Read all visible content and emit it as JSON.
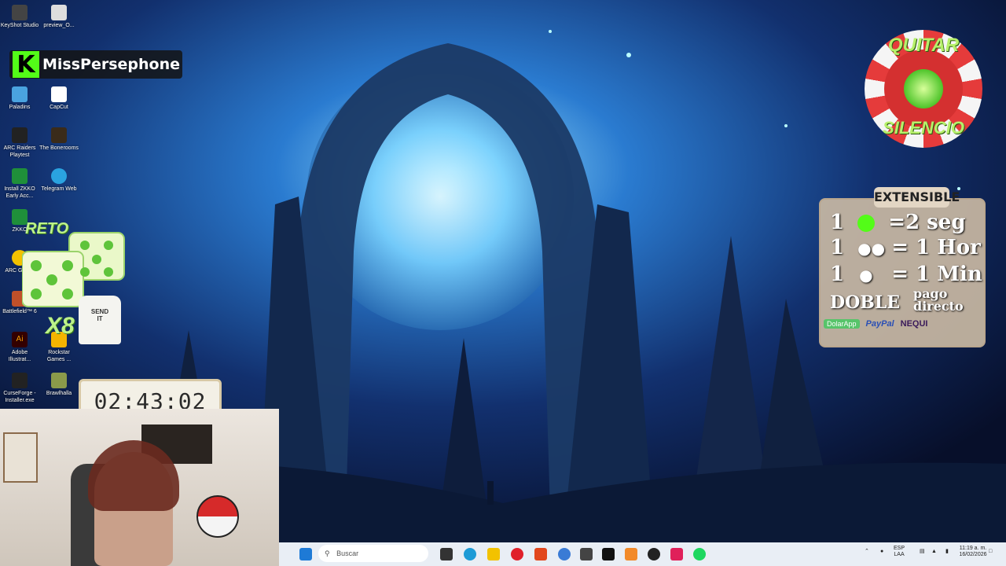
{
  "desktop_icons": [
    {
      "label": "KeyShot Studio",
      "color": "#444444"
    },
    {
      "label": "preview_O...",
      "color": "#dddddd"
    },
    {
      "label": "Paladins",
      "color": "#4aa3df"
    },
    {
      "label": "CapCut",
      "color": "#ffffff"
    },
    {
      "label": "ARC Raiders Playtest",
      "color": "#222222"
    },
    {
      "label": "The Bonerooms",
      "color": "#3a2b1a"
    },
    {
      "label": "Install ZKKO Early Acc...",
      "color": "#1f8f3a"
    },
    {
      "label": "Telegram Web",
      "color": "#2aa3e0"
    },
    {
      "label": "ZKKO",
      "color": "#1f8f3a"
    },
    {
      "label": "ARC GAME",
      "color": "#f2c200"
    },
    {
      "label": "Battlefield™ 6",
      "color": "#c0502a"
    },
    {
      "label": "Adobe Illustrat...",
      "color": "#ff9a00"
    },
    {
      "label": "Rockstar Games ...",
      "color": "#f4b400"
    },
    {
      "label": "CurseForge - Installer.exe",
      "color": "#222222"
    },
    {
      "label": "Brawlhalla",
      "color": "#8a9a4a"
    }
  ],
  "overlay": {
    "kick_letter": "K",
    "streamer_name": "MissPersephone",
    "quit_silence_top": "QUITAR",
    "quit_silence_bottom": "SILENCIO",
    "challenge_label": "RETO",
    "challenge_multiplier": "X8",
    "shirt_text": "SEND IT",
    "timer": "02:43:02"
  },
  "extensible_panel": {
    "title": "EXTENSIBLE",
    "row1_count": "1",
    "row1_value": "=2 seg",
    "row2_count": "1",
    "row2_value": "= 1 Hor",
    "row3_count": "1",
    "row3_value": "= 1 Min",
    "row4_label": "DOBLE",
    "row4_value_top": "pago",
    "row4_value_bottom": "directo",
    "payments": [
      "DolarApp",
      "PayPal",
      "NEQUI"
    ]
  },
  "taskbar": {
    "search_placeholder": "Buscar",
    "language_top": "ESP",
    "language_bottom": "LAA",
    "time": "11:19 a. m.",
    "date": "16/02/2026"
  },
  "colors": {
    "kick_green": "#53fc18",
    "panel_bg": "#c9b8a3",
    "taskbar_bg": "#e9eef5"
  }
}
